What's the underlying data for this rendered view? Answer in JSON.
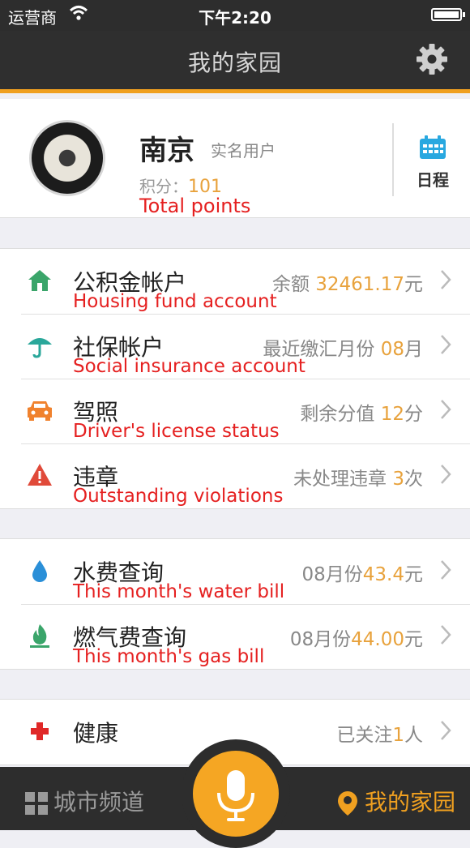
{
  "status_bar": {
    "carrier": "运营商",
    "time": "下午2:20"
  },
  "nav": {
    "title": "我的家园"
  },
  "profile": {
    "name": "南京",
    "tag": "实名用户",
    "points_label": "积分：",
    "points_value": "101",
    "note": "Total points",
    "schedule_label": "日程"
  },
  "groups": {
    "accounts": [
      {
        "label": "公积金帐户",
        "value_prefix": "余额 ",
        "value_num": "32461.17",
        "value_suffix": "元",
        "note": "Housing fund account",
        "icon": "house-icon",
        "icon_color": "#3aa56a"
      },
      {
        "label": "社保帐户",
        "value_prefix": "最近缴汇月份 ",
        "value_num": "08",
        "value_suffix": "月",
        "note": "Social insurance account",
        "icon": "umbrella-icon",
        "icon_color": "#2aa79a"
      },
      {
        "label": "驾照",
        "value_prefix": "剩余分值 ",
        "value_num": "12",
        "value_suffix": "分",
        "note": "Driver's license status",
        "icon": "car-icon",
        "icon_color": "#f0822e"
      },
      {
        "label": "违章",
        "value_prefix": "未处理违章 ",
        "value_num": "3",
        "value_suffix": "次",
        "note": "Outstanding violations",
        "icon": "warning-icon",
        "icon_color": "#e04a3a"
      }
    ],
    "bills": [
      {
        "label": "水费查询",
        "value_prefix": "08月份",
        "value_num": "43.4",
        "value_suffix": "元",
        "note": "This month's water bill",
        "icon": "water-drop-icon",
        "icon_color": "#2a8fd8"
      },
      {
        "label": "燃气费查询",
        "value_prefix": "08月份",
        "value_num": "44.00",
        "value_suffix": "元",
        "note": "This month's gas bill",
        "icon": "flame-icon",
        "icon_color": "#3aa56a"
      }
    ],
    "health": [
      {
        "label": "健康",
        "value_prefix": "已关注",
        "value_num": "1",
        "value_suffix": "人",
        "note": "",
        "icon": "red-cross-icon",
        "icon_color": "#e02828"
      }
    ]
  },
  "bottom_bar": {
    "city_tab": "城市频道",
    "home_tab": "我的家园"
  },
  "colors": {
    "accent": "#f5a623",
    "dark": "#2d2d2d",
    "alert": "#e52020"
  }
}
